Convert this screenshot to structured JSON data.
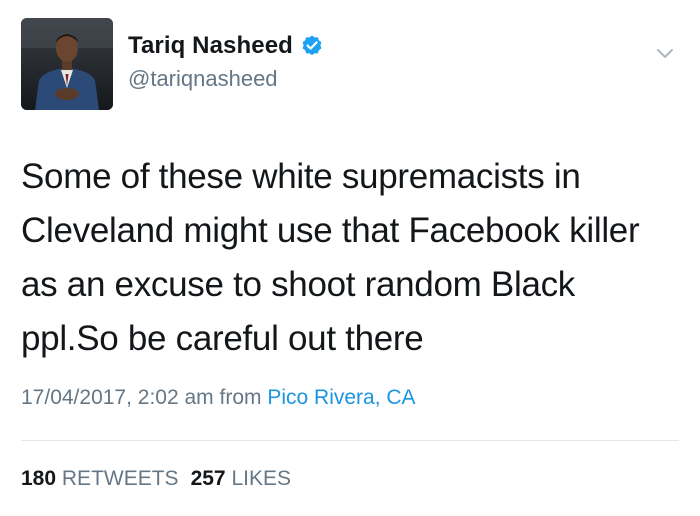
{
  "author": {
    "display_name": "Tariq Nasheed",
    "handle": "@tariqnasheed",
    "avatar": "profile-photo",
    "verified_icon": "verified-badge-icon",
    "accent": "#1da1f2"
  },
  "tweet": {
    "lines": [
      "Some of these white supremacists in",
      "Cleveland might use that Facebook killer",
      "as an excuse to shoot random Black",
      "ppl.So be careful out there"
    ],
    "timestamp": "17/04/2017, 2:02 am",
    "from_label": "from",
    "location": "Pico Rivera, CA"
  },
  "stats": {
    "retweets_count": "180",
    "retweets_label": "RETWEETS",
    "likes_count": "257",
    "likes_label": "LIKES"
  },
  "menu_icon": "chevron-down-icon"
}
